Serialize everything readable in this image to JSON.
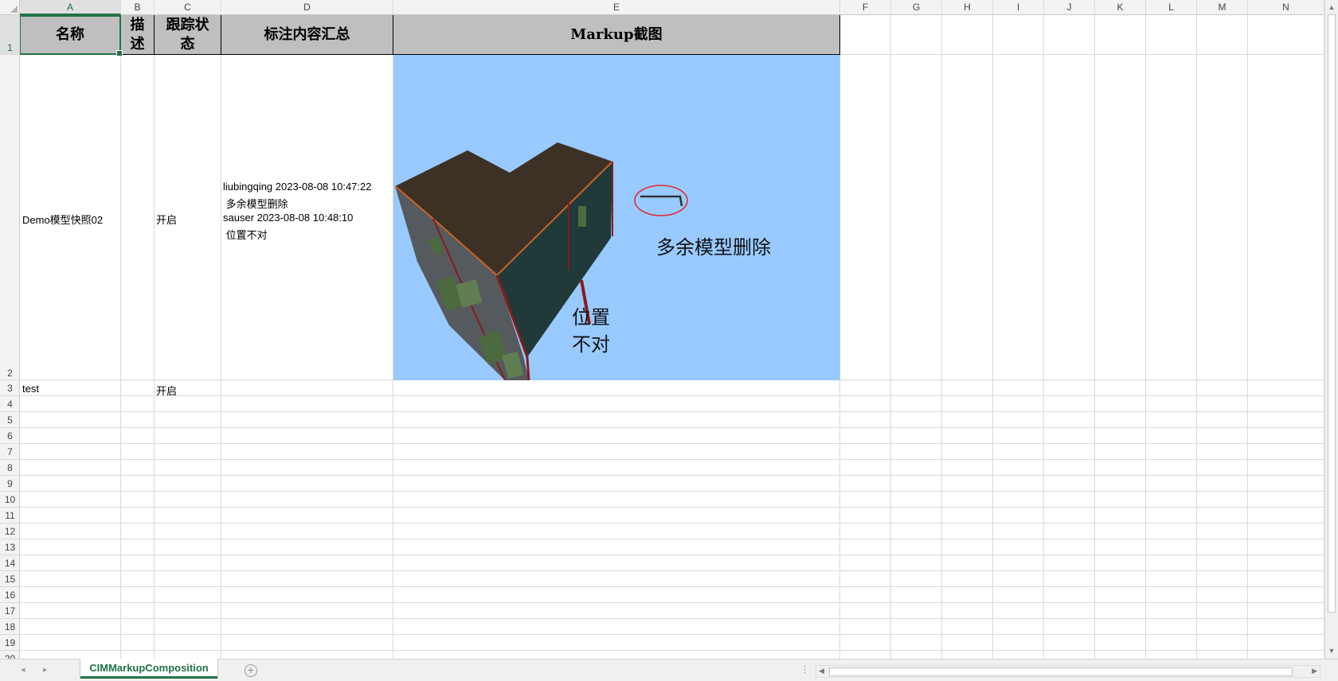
{
  "columns": [
    "A",
    "B",
    "C",
    "D",
    "E",
    "F",
    "G",
    "H",
    "I",
    "J",
    "K",
    "L",
    "M",
    "N"
  ],
  "rows": [
    "1",
    "2",
    "3",
    "4",
    "5",
    "6",
    "7",
    "8",
    "9",
    "10",
    "11",
    "12",
    "13",
    "14",
    "15",
    "16",
    "17",
    "18",
    "19",
    "20"
  ],
  "header": {
    "name": "名称",
    "desc": "描述",
    "status": "跟踪状态",
    "summary": "标注内容汇总",
    "screenshot": "Markup截图"
  },
  "row2": {
    "name": "Demo模型快照02",
    "status": "开启",
    "summary_lines": [
      "liubingqing 2023-08-08 10:47:22",
      " 多余模型删除",
      "sauser 2023-08-08 10:48:10",
      " 位置不对"
    ]
  },
  "row3": {
    "name": "test",
    "status": "开启"
  },
  "markup_image": {
    "annotation_1": "多余模型删除",
    "annotation_2_line1": "位置",
    "annotation_2_line2": "不对",
    "background_color": "#99caff",
    "circle_color": "#e0282d"
  },
  "sheet_tab": "CIMMarkupComposition",
  "colors": {
    "accent": "#217346",
    "header_fill": "#bfbfbf"
  }
}
